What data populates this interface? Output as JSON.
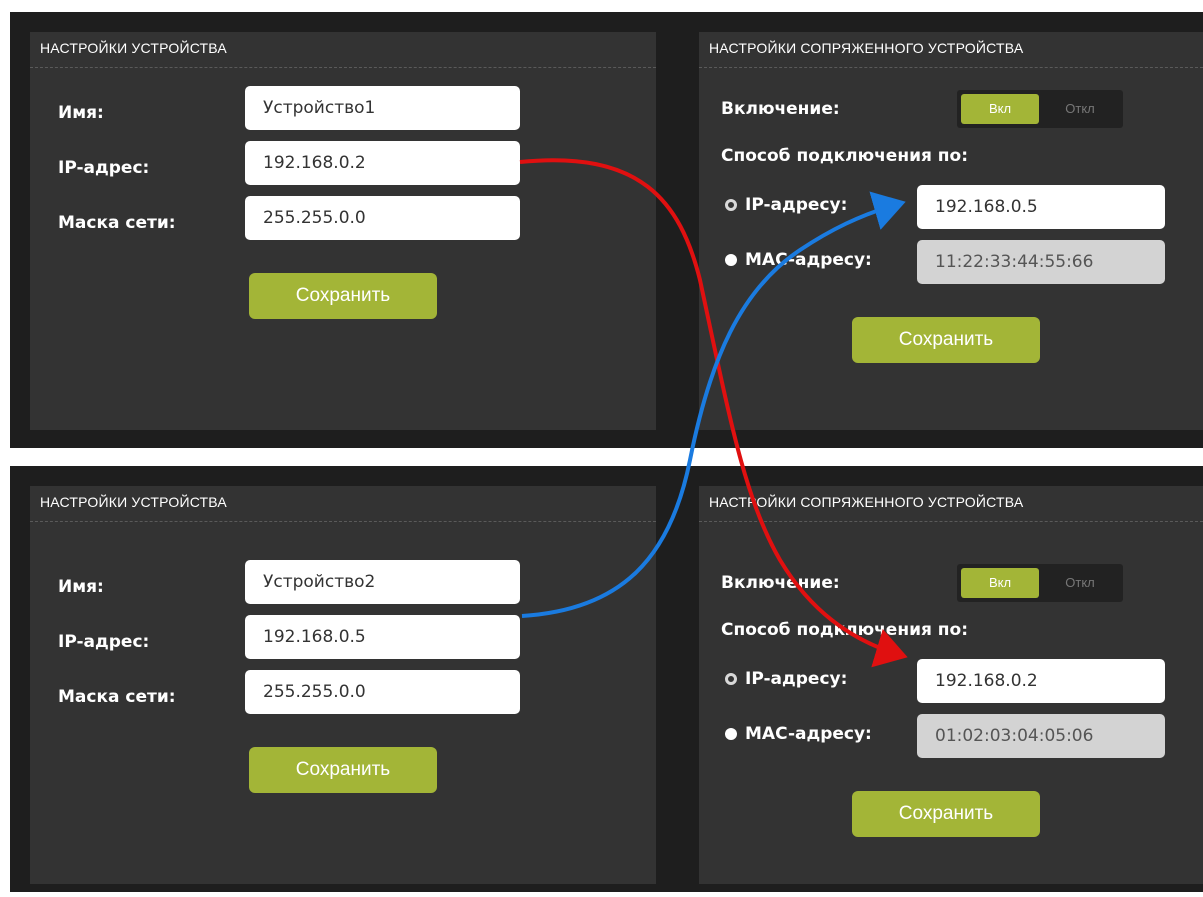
{
  "device1": {
    "settings": {
      "title": "НАСТРОЙКИ УСТРОЙСТВА",
      "name_label": "Имя:",
      "name_value": "Устройство1",
      "ip_label": "IP-адрес:",
      "ip_value": "192.168.0.2",
      "mask_label": "Маска сети:",
      "mask_value": "255.255.0.0",
      "save_label": "Сохранить"
    },
    "paired": {
      "title": "НАСТРОЙКИ СОПРЯЖЕННОГО УСТРОЙСТВА",
      "enable_label": "Включение:",
      "toggle_on": "Вкл",
      "toggle_off": "Откл",
      "connect_label": "Способ подключения по:",
      "ip_option_label": "IP-адресу:",
      "ip_value": "192.168.0.5",
      "mac_option_label": "MAC-адресу:",
      "mac_value": "11:22:33:44:55:66",
      "save_label": "Сохранить",
      "selected": "ip"
    }
  },
  "device2": {
    "settings": {
      "title": "НАСТРОЙКИ УСТРОЙСТВА",
      "name_label": "Имя:",
      "name_value": "Устройство2",
      "ip_label": "IP-адрес:",
      "ip_value": "192.168.0.5",
      "mask_label": "Маска сети:",
      "mask_value": "255.255.0.0",
      "save_label": "Сохранить"
    },
    "paired": {
      "title": "НАСТРОЙКИ СОПРЯЖЕННОГО УСТРОЙСТВА",
      "enable_label": "Включение:",
      "toggle_on": "Вкл",
      "toggle_off": "Откл",
      "connect_label": "Способ подключения по:",
      "ip_option_label": "IP-адресу:",
      "ip_value": "192.168.0.2",
      "mac_option_label": "MAC-адресу:",
      "mac_value": "01:02:03:04:05:06",
      "save_label": "Сохранить",
      "selected": "ip"
    }
  },
  "colors": {
    "accent_green": "#a3b537",
    "panel_bg": "#333333",
    "frame_bg": "#1e1e1e",
    "arrow_red": "#e01010",
    "arrow_blue": "#1a7be0"
  },
  "icons": [
    "radio-selected-icon",
    "radio-unselected-icon",
    "arrow-red",
    "arrow-blue"
  ]
}
